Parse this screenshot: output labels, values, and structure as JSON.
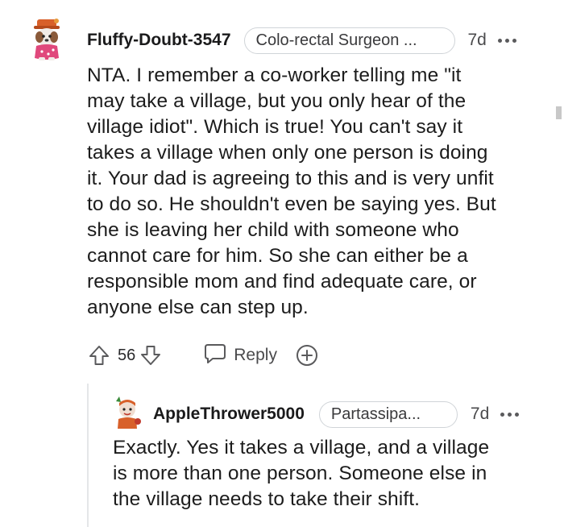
{
  "comment": {
    "username": "Fluffy-Doubt-3547",
    "flair": "Colo-rectal Surgeon ...",
    "time": "7d",
    "lines": [
      "NTA. I remember a co-worker telling me \"it",
      "may take a village, but you only hear of the",
      "village idiot\". Which is true! You can't say it",
      "takes a village when only one person is doing",
      "it. Your dad is agreeing to this and is very unfit",
      "to do so. He shouldn't even be saying yes. But",
      "she is leaving her child with someone who",
      "cannot care for him. So she can either be a",
      "responsible mom and find adequate care, or",
      "anyone else can step up."
    ],
    "score": "56",
    "reply_label": "Reply"
  },
  "reply": {
    "username": "AppleThrower5000",
    "flair": "Partassipa...",
    "time": "7d",
    "lines": [
      "Exactly. Yes it takes a village, and a village",
      "is more than one person. Someone else in",
      "the village needs to take their shift."
    ]
  },
  "icons": {
    "upvote": "upvote-icon",
    "downvote": "downvote-icon",
    "reply": "comment-bubble-icon",
    "award": "plus-circle-icon",
    "more": "more-options-icon"
  },
  "colors": {
    "text": "#1a1a1b",
    "muted": "#4a4a4c",
    "flair_border": "#d0d4d8",
    "thread_line": "#e4e6e8"
  }
}
